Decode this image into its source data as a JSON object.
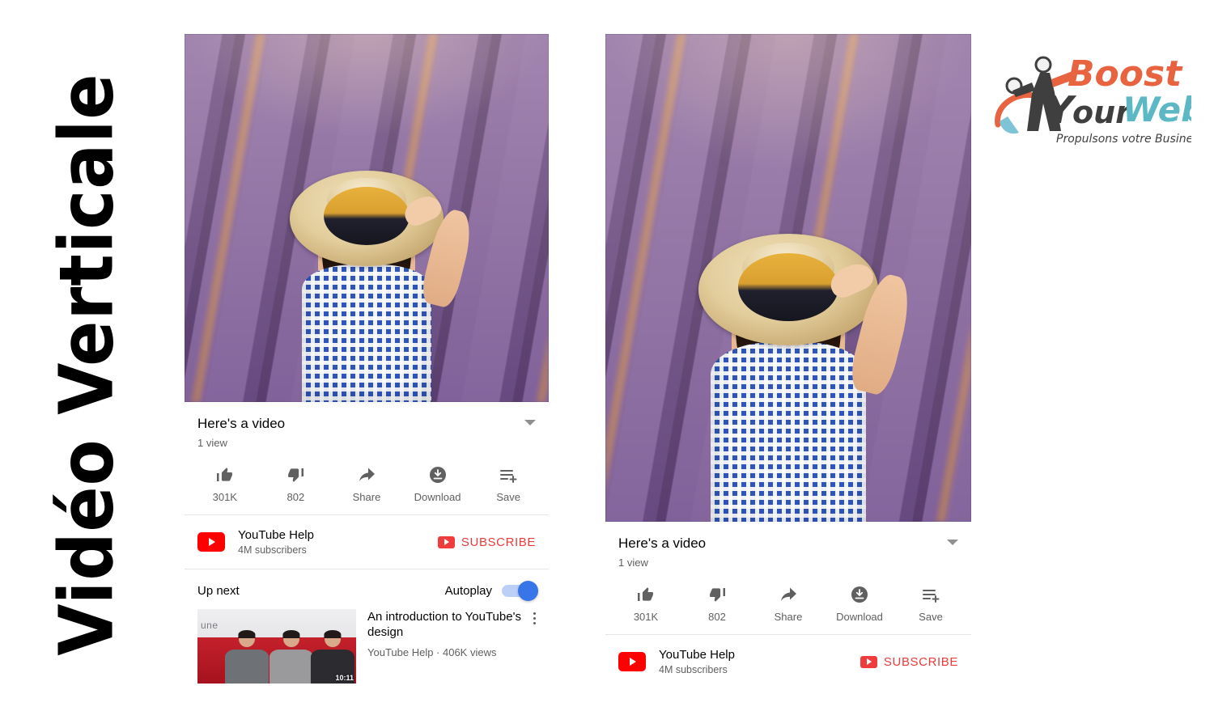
{
  "headline": {
    "text": "Vidéo Verticale"
  },
  "brand": {
    "word_boost": "Boost",
    "word_your": "our",
    "word_web": "Web",
    "letter_y": "Y",
    "tagline": "Propulsons votre Business",
    "color_orange": "#e8633f",
    "color_teal": "#5bb8c4",
    "color_dark": "#3f3f3f"
  },
  "panels": [
    {
      "id": "square-video-panel",
      "video": {
        "title": "Here's a video",
        "views": "1 view",
        "scene_alt": "Woman in blue gingham dress and straw hat in a lavender field"
      },
      "actions": [
        {
          "icon": "thumbs-up-icon",
          "label": "301K"
        },
        {
          "icon": "thumbs-down-icon",
          "label": "802"
        },
        {
          "icon": "share-icon",
          "label": "Share"
        },
        {
          "icon": "download-icon",
          "label": "Download"
        },
        {
          "icon": "save-to-playlist-icon",
          "label": "Save"
        }
      ],
      "channel": {
        "name": "YouTube Help",
        "subscribers": "4M subscribers",
        "subscribe_label": "SUBSCRIBE",
        "subscribe_color": "#eb3b3b"
      },
      "up_next": {
        "heading": "Up next",
        "autoplay_label": "Autoplay",
        "autoplay_on": true,
        "toggle_color": "#3875e8",
        "item": {
          "title": "An introduction to YouTube's design",
          "meta": "YouTube Help · 406K views",
          "thumb_watermark": "une",
          "thumb_duration": "10:11"
        }
      }
    },
    {
      "id": "vertical-video-panel",
      "video": {
        "title": "Here's a video",
        "views": "1 view",
        "scene_alt": "Woman in blue gingham dress and straw hat in a lavender field"
      },
      "actions": [
        {
          "icon": "thumbs-up-icon",
          "label": "301K"
        },
        {
          "icon": "thumbs-down-icon",
          "label": "802"
        },
        {
          "icon": "share-icon",
          "label": "Share"
        },
        {
          "icon": "download-icon",
          "label": "Download"
        },
        {
          "icon": "save-to-playlist-icon",
          "label": "Save"
        }
      ],
      "channel": {
        "name": "YouTube Help",
        "subscribers": "4M subscribers",
        "subscribe_label": "SUBSCRIBE",
        "subscribe_color": "#eb3b3b"
      }
    }
  ]
}
